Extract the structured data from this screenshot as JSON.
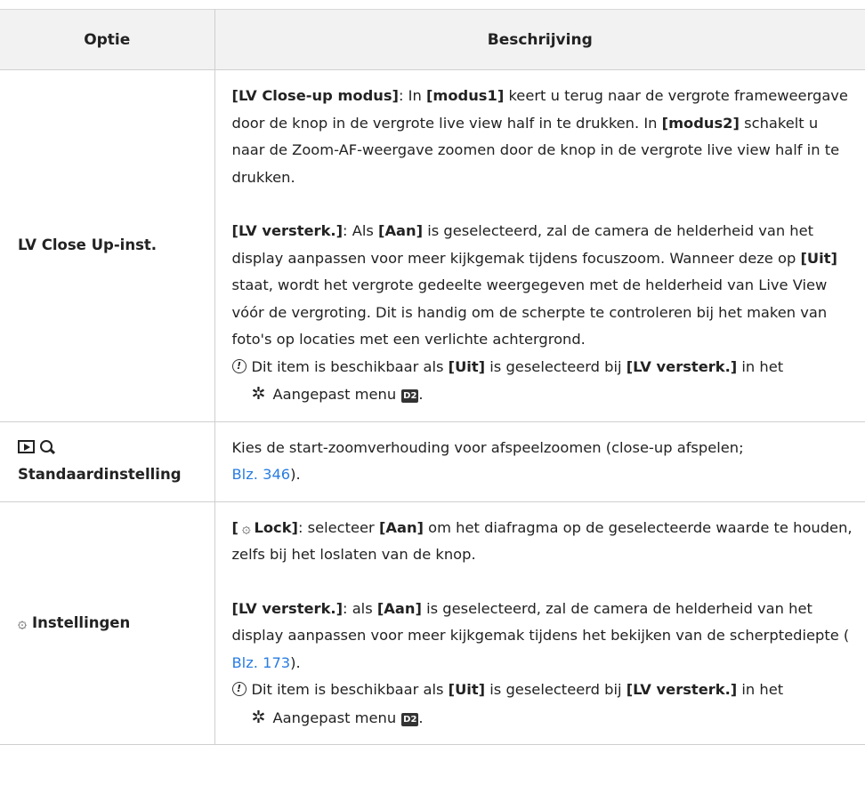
{
  "header": {
    "col1": "Optie",
    "col2": "Beschrijving"
  },
  "rows": [
    {
      "option": "LV Close Up-inst.",
      "p1": {
        "b1": "[LV Close-up modus]",
        "t1": ": In ",
        "b2": "[modus1]",
        "t2": " keert u terug naar de vergrote frameweergave door de knop in de vergrote live view half in te drukken. In ",
        "b3": "[modus2]",
        "t3": " schakelt u naar de Zoom-AF-weergave zoomen door de knop in de vergrote live view half in te drukken."
      },
      "p2": {
        "b1": "[LV versterk.]",
        "t1": ": Als ",
        "b2": "[Aan]",
        "t2": " is geselecteerd, zal de camera de helderheid van het display aanpassen voor meer kijkgemak tijdens focuszoom. Wanneer deze op ",
        "b3": "[Uit]",
        "t3": " staat, wordt het vergrote gedeelte weergegeven met de helderheid van Live View vóór de vergroting. Dit is handig om de scherpte te controleren bij het maken van foto's op locaties met een verlichte achtergrond."
      },
      "note": {
        "t1": "Dit item is beschikbaar als ",
        "b1": "[Uit]",
        "t2": " is geselecteerd bij ",
        "b2": "[LV versterk.]",
        "t3": " in het",
        "menu": "Aangepast menu",
        "badge": "D2",
        "end": "."
      }
    },
    {
      "option": "Standaardinstelling",
      "desc": "Kies de start-zoomverhouding voor afspeelzoomen (close-up afspelen;",
      "link": "Blz. 346",
      "end": ")."
    },
    {
      "option": "Instellingen",
      "p1": {
        "b0": "[",
        "b1": "Lock]",
        "t1": ": selecteer ",
        "b2": "[Aan]",
        "t2": " om het diafragma op de geselecteerde waarde te houden, zelfs bij het loslaten van de knop."
      },
      "p2": {
        "b1": "[LV versterk.]",
        "t1": ": als ",
        "b2": "[Aan]",
        "t2": " is geselecteerd, zal de camera de helderheid van het display aanpassen voor meer kijkgemak tijdens het bekijken van de scherptediepte ( ",
        "link": "Blz. 173",
        "t3": ")."
      },
      "note": {
        "t1": "Dit item is beschikbaar als ",
        "b1": "[Uit]",
        "t2": " is geselecteerd bij ",
        "b2": "[LV versterk.]",
        "t3": " in het",
        "menu": "Aangepast menu",
        "badge": "D2",
        "end": "."
      }
    }
  ]
}
